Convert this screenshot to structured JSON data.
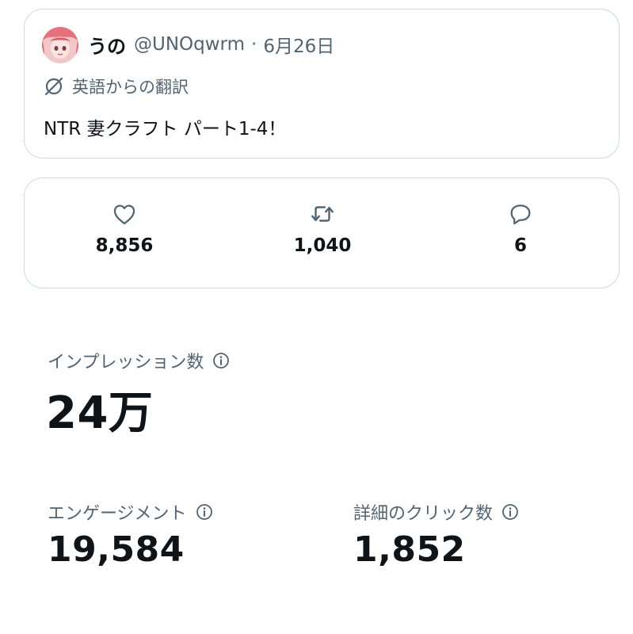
{
  "tweet": {
    "author_name": "うの",
    "author_handle": "@UNOqwrm",
    "separator": "·",
    "date": "6月26日",
    "translation_label": "英語からの翻訳",
    "text": "NTR 妻クラフト パート1-4！",
    "avatar_icon": "avatar-image",
    "translate_icon": "globe-slash-icon"
  },
  "stats": {
    "likes": {
      "icon": "heart-icon",
      "value": "8,856"
    },
    "retweets": {
      "icon": "retweet-icon",
      "value": "1,040"
    },
    "replies": {
      "icon": "reply-icon",
      "value": "6"
    }
  },
  "metrics": {
    "impressions": {
      "label": "インプレッション数",
      "value": "24万",
      "icon": "info-icon"
    },
    "engagements": {
      "label": "エンゲージメント",
      "value": "19,584",
      "icon": "info-icon"
    },
    "detail_clicks": {
      "label": "詳細のクリック数",
      "value": "1,852",
      "icon": "info-icon"
    }
  },
  "colors": {
    "text_primary": "#0f1419",
    "text_secondary": "#536471",
    "border": "#cfd9de",
    "avatar_hair": "#e8707a"
  }
}
